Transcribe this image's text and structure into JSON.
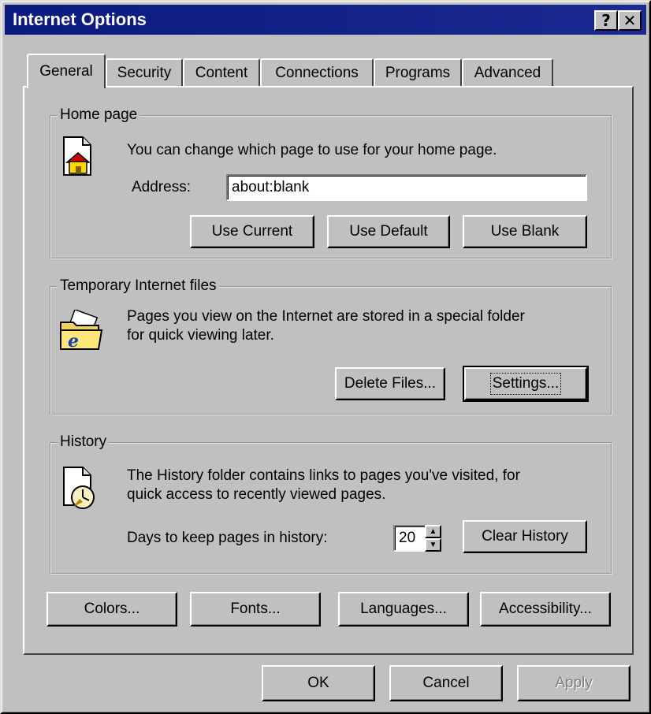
{
  "window": {
    "title": "Internet Options",
    "help_glyph": "?",
    "close_glyph": "✕"
  },
  "tabs": [
    {
      "label": "General"
    },
    {
      "label": "Security"
    },
    {
      "label": "Content"
    },
    {
      "label": "Connections"
    },
    {
      "label": "Programs"
    },
    {
      "label": "Advanced"
    }
  ],
  "active_tab": "General",
  "home_page": {
    "group_label": "Home page",
    "description": "You can change which page to use for your home page.",
    "address_label": "Address:",
    "address_value": "about:blank",
    "icon": "home-page-icon",
    "use_current": "Use Current",
    "use_default": "Use Default",
    "use_blank": "Use Blank"
  },
  "temp_files": {
    "group_label": "Temporary Internet files",
    "description_line1": "Pages you view on the Internet are stored in a special folder",
    "description_line2": "for quick viewing later.",
    "icon": "ie-folder-icon",
    "delete_files": "Delete Files...",
    "settings": "Settings..."
  },
  "history": {
    "group_label": "History",
    "description_line1": "The History folder contains links to pages you've visited, for",
    "description_line2": "quick access to recently viewed pages.",
    "days_label": "Days to keep pages in history:",
    "days_value": "20",
    "icon": "history-clock-icon",
    "clear_history": "Clear History"
  },
  "bottom_buttons": {
    "colors": "Colors...",
    "fonts": "Fonts...",
    "languages": "Languages...",
    "accessibility": "Accessibility..."
  },
  "dialog_buttons": {
    "ok": "OK",
    "cancel": "Cancel",
    "apply": "Apply"
  }
}
